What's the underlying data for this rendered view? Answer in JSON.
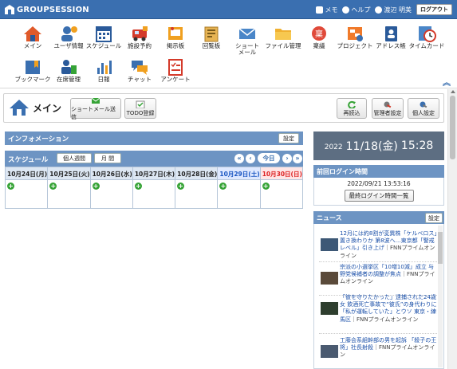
{
  "app": {
    "logo": "GROUPSESSION"
  },
  "top_links": {
    "memo": "メモ",
    "help": "ヘルプ",
    "user": "渡辺 明美",
    "logout": "ログアウト"
  },
  "menu": [
    {
      "label": "メイン",
      "icon": "home-icon"
    },
    {
      "label": "ユーザ情報",
      "icon": "user-info-icon"
    },
    {
      "label": "スケジュール",
      "icon": "schedule-icon"
    },
    {
      "label": "施設予約",
      "icon": "facility-icon"
    },
    {
      "label": "掲示板",
      "icon": "bulletin-icon"
    },
    {
      "label": "回覧板",
      "icon": "circular-icon"
    },
    {
      "label": "ショート\nメール",
      "icon": "mail-icon"
    },
    {
      "label": "ファイル管理",
      "icon": "folder-icon"
    },
    {
      "label": "稟議",
      "icon": "approval-icon"
    },
    {
      "label": "プロジェクト",
      "icon": "project-icon"
    },
    {
      "label": "アドレス帳",
      "icon": "address-book-icon"
    },
    {
      "label": "タイムカード",
      "icon": "timecard-icon"
    },
    {
      "label": "ブックマーク",
      "icon": "bookmark-icon"
    },
    {
      "label": "在席管理",
      "icon": "presence-icon"
    },
    {
      "label": "日報",
      "icon": "report-icon"
    },
    {
      "label": "チャット",
      "icon": "chat-icon"
    },
    {
      "label": "アンケート",
      "icon": "survey-icon"
    }
  ],
  "page": {
    "title": "メイン",
    "btn_short_mail": "ショートメール送信",
    "btn_todo": "TODO登録",
    "btn_reload": "再読込",
    "btn_admin": "管理者設定",
    "btn_personal": "個人設定"
  },
  "info": {
    "title": "インフォメーション",
    "settings": "設定"
  },
  "schedule": {
    "title": "スケジュール",
    "week_btn": "個人週間",
    "month_btn": "月 間",
    "today_btn": "今日",
    "days": [
      "10月24日(月)",
      "10月25日(火)",
      "10月26日(水)",
      "10月27日(木)",
      "10月28日(金)",
      "10月29日(土)",
      "10月30日(日)"
    ]
  },
  "clock": {
    "year": "2022",
    "date": "11/18(金)",
    "time": "15:28"
  },
  "last_login": {
    "title": "前回ログイン時間",
    "datetime": "2022/09/21 13:53:16",
    "btn": "最終ログイン時間一覧"
  },
  "news": {
    "title": "ニュース",
    "settings": "設定",
    "items": [
      {
        "text": "12月には約8割が変異株「ケルベロス」置き換わりか 第8波へ…東京都「警戒レベル」引き上げ",
        "source": "｜FNNプライムオンライン"
      },
      {
        "text": "宗派の小選挙区「10増10減」成立 与野党候補者の調整が焦点",
        "source": "｜FNNプライムオンライン"
      },
      {
        "text": "「彼を守りたかった」逮捕された24歳女 飲酒死亡事故で“彼氏”の身代わりに「私が運転していた」とウソ 東京・練馬区",
        "source": "｜FNNプライムオンライン"
      },
      {
        "text": "工藤会系組幹部の男を起訴 「殺子の王将」社長射殺",
        "source": "｜FNNプライムオンライン"
      }
    ]
  },
  "colors": {
    "header": "#3a6fb0",
    "section": "#6d94c3",
    "clock_bg": "#5d6e82"
  }
}
